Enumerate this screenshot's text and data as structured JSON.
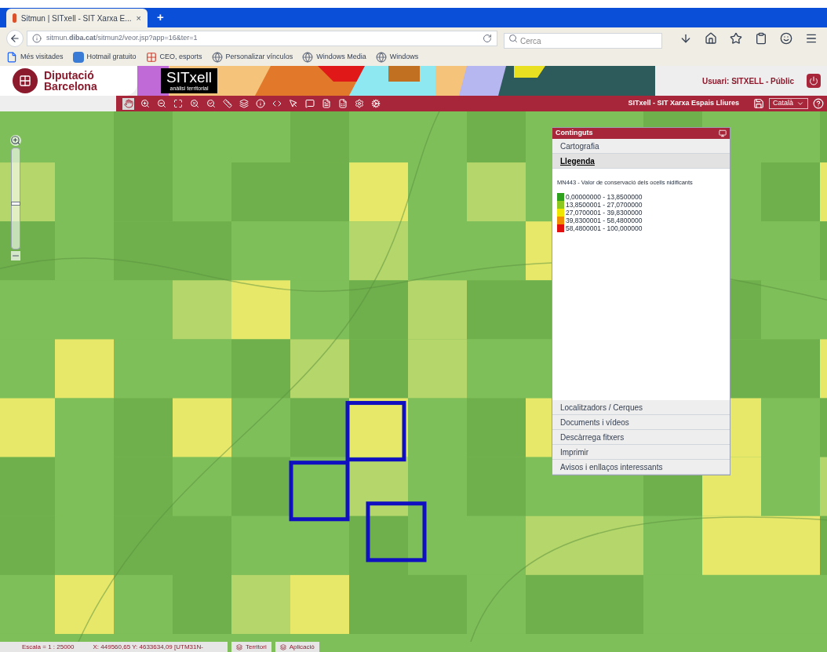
{
  "browser": {
    "tab_title": "Sitmun | SITxell - SIT Xarxa E...",
    "close_glyph": "×",
    "new_tab_glyph": "+",
    "url": "sitmun.**diba.cat**/sitmun2/veor.jsp?app=16&ter=1",
    "search_placeholder": "Cerca",
    "bookmarks": [
      {
        "label": "Més visitades",
        "kind": "page"
      },
      {
        "label": "Hotmail gratuito",
        "kind": "m"
      },
      {
        "label": "CEO, esports",
        "kind": "grid"
      },
      {
        "label": "Personalizar vínculos",
        "kind": "globe"
      },
      {
        "label": "Windows Media",
        "kind": "globe"
      },
      {
        "label": "Windows",
        "kind": "globe"
      }
    ]
  },
  "header": {
    "org_lines": [
      "Diputació",
      "Barcelona"
    ],
    "app_logo": "SITxell",
    "app_logo_sub": "anàlisi territorial",
    "user": "Usuari: SITXELL - Públic"
  },
  "toolbar": {
    "tools": [
      {
        "selected": true
      },
      {
        "selected": false
      },
      {
        "selected": false
      },
      {
        "selected": false
      },
      {
        "selected": false
      },
      {
        "selected": false
      },
      {
        "selected": false
      },
      {
        "selected": false
      },
      {
        "selected": false
      },
      {
        "selected": false
      },
      {
        "selected": false
      },
      {
        "selected": false
      },
      {
        "selected": false
      },
      {
        "selected": false
      },
      {
        "selected": false
      },
      {
        "selected": false
      }
    ],
    "title": "SITxell - SIT Xarxa Espais Lliures",
    "language": "Català"
  },
  "zoom": {
    "level": 0.45
  },
  "panel": {
    "title": "Continguts",
    "sections_top": [
      {
        "label": "Cartografia",
        "selected": false
      },
      {
        "label": "Llegenda",
        "selected": true
      }
    ],
    "legend_title": "MN443 - Valor de conservació dels ocells nidificants",
    "legend": [
      {
        "label": "0,00000000 - 13,8500000",
        "color": "#2ea01e"
      },
      {
        "label": "13,8500001 - 27,0700000",
        "color": "#8cc81e"
      },
      {
        "label": "27,0700001 - 39,8300000",
        "color": "#f0e600"
      },
      {
        "label": "39,8300001 - 58,4800000",
        "color": "#f08c00"
      },
      {
        "label": "58,4800001 - 100,000000",
        "color": "#e01010"
      }
    ],
    "sections_bottom": [
      {
        "label": "Localitzadors / Cerques",
        "selected": false
      },
      {
        "label": "Documents i vídeos",
        "selected": false
      },
      {
        "label": "Descàrrega fitxers",
        "selected": false
      },
      {
        "label": "Imprimir",
        "selected": false
      },
      {
        "label": "Avisos i enllaços interessants",
        "selected": false
      }
    ]
  },
  "status_bar": {
    "scale": "Escala = 1 : 25000",
    "coords": "X: 449560,65 Y: 4633634,09 [UTM31N-",
    "buttons": [
      "Territori",
      "Aplicació"
    ]
  }
}
